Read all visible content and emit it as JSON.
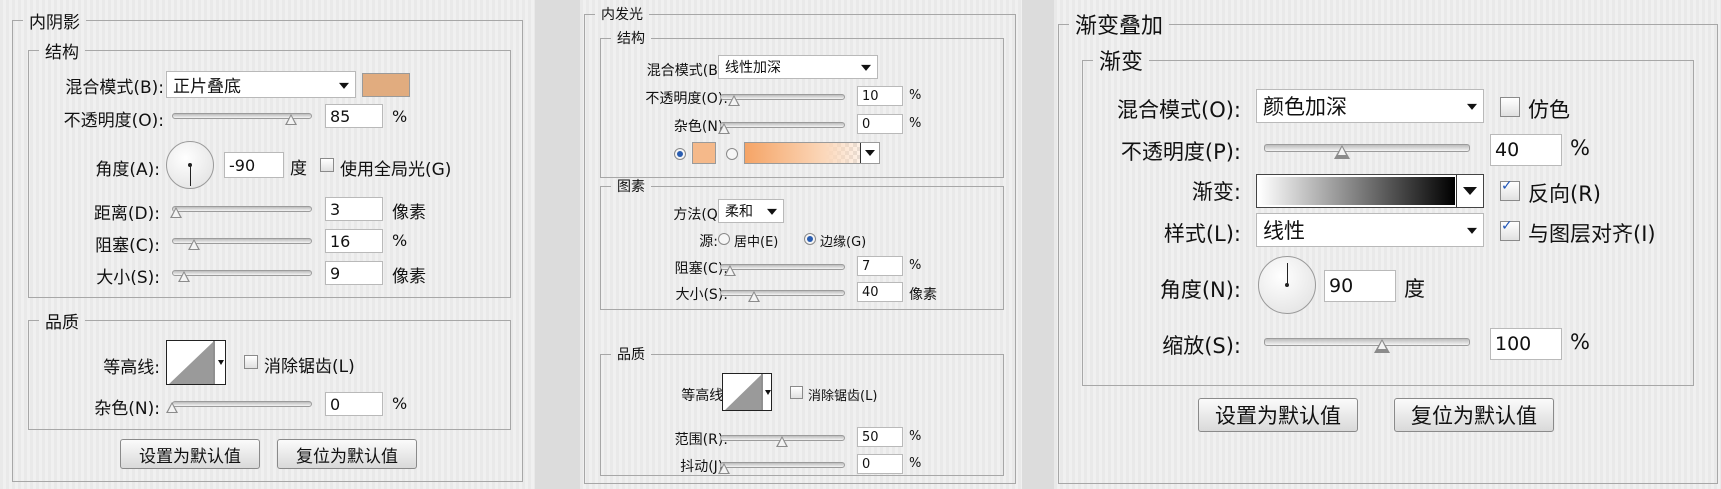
{
  "inner_shadow": {
    "title": "内阴影",
    "structure": {
      "title": "结构",
      "blend_mode_label": "混合模式(B):",
      "blend_mode_value": "正片叠底",
      "swatch_color": "#e1ac7f",
      "opacity_label": "不透明度(O):",
      "opacity_value": "85",
      "opacity_unit": "%",
      "opacity_pct": 85,
      "angle_label": "角度(A):",
      "angle_value": "-90",
      "angle_unit": "度",
      "global_light_label": "使用全局光(G)",
      "distance_label": "距离(D):",
      "distance_value": "3",
      "distance_unit": "像素",
      "distance_pct": 3,
      "choke_label": "阻塞(C):",
      "choke_value": "16",
      "choke_unit": "%",
      "choke_pct": 16,
      "size_label": "大小(S):",
      "size_value": "9",
      "size_unit": "像素",
      "size_pct": 9
    },
    "quality": {
      "title": "品质",
      "contour_label": "等高线:",
      "antialias_label": "消除锯齿(L)",
      "noise_label": "杂色(N):",
      "noise_value": "0",
      "noise_unit": "%"
    },
    "set_default_label": "设置为默认值",
    "reset_default_label": "复位为默认值"
  },
  "outer_glow": {
    "title": "内发光",
    "structure": {
      "title": "结构",
      "blend_mode_label": "混合模式(B):",
      "blend_mode_value": "线性加深",
      "opacity_label": "不透明度(O):",
      "opacity_value": "10",
      "opacity_unit": "%",
      "noise_label": "杂色(N):",
      "noise_value": "0",
      "noise_unit": "%",
      "color_swatch": "#f5b98a"
    },
    "elements": {
      "title": "图素",
      "method_label": "方法(Q):",
      "method_value": "柔和",
      "source_label": "源:",
      "source_center_label": "居中(E)",
      "source_edge_label": "边缘(G)",
      "choke_label": "阻塞(C):",
      "choke_value": "7",
      "choke_unit": "%",
      "size_label": "大小(S):",
      "size_value": "40",
      "size_unit": "像素"
    },
    "quality": {
      "title": "品质",
      "contour_label": "等高线:",
      "antialias_label": "消除锯齿(L)",
      "range_label": "范围(R):",
      "range_value": "50",
      "range_unit": "%",
      "jitter_label": "抖动(J):",
      "jitter_value": "0",
      "jitter_unit": "%"
    }
  },
  "gradient_overlay": {
    "title": "渐变叠加",
    "gradient_group_title": "渐变",
    "blend_mode_label": "混合模式(O):",
    "blend_mode_value": "颜色加深",
    "dither_label": "仿色",
    "opacity_label": "不透明度(P):",
    "opacity_value": "40",
    "opacity_unit": "%",
    "gradient_label": "渐变:",
    "reverse_label": "反向(R)",
    "style_label": "样式(L):",
    "style_value": "线性",
    "align_label": "与图层对齐(I)",
    "angle_label": "角度(N):",
    "angle_value": "90",
    "angle_unit": "度",
    "scale_label": "缩放(S):",
    "scale_value": "100",
    "scale_unit": "%",
    "set_default_label": "设置为默认值",
    "reset_default_label": "复位为默认值"
  }
}
